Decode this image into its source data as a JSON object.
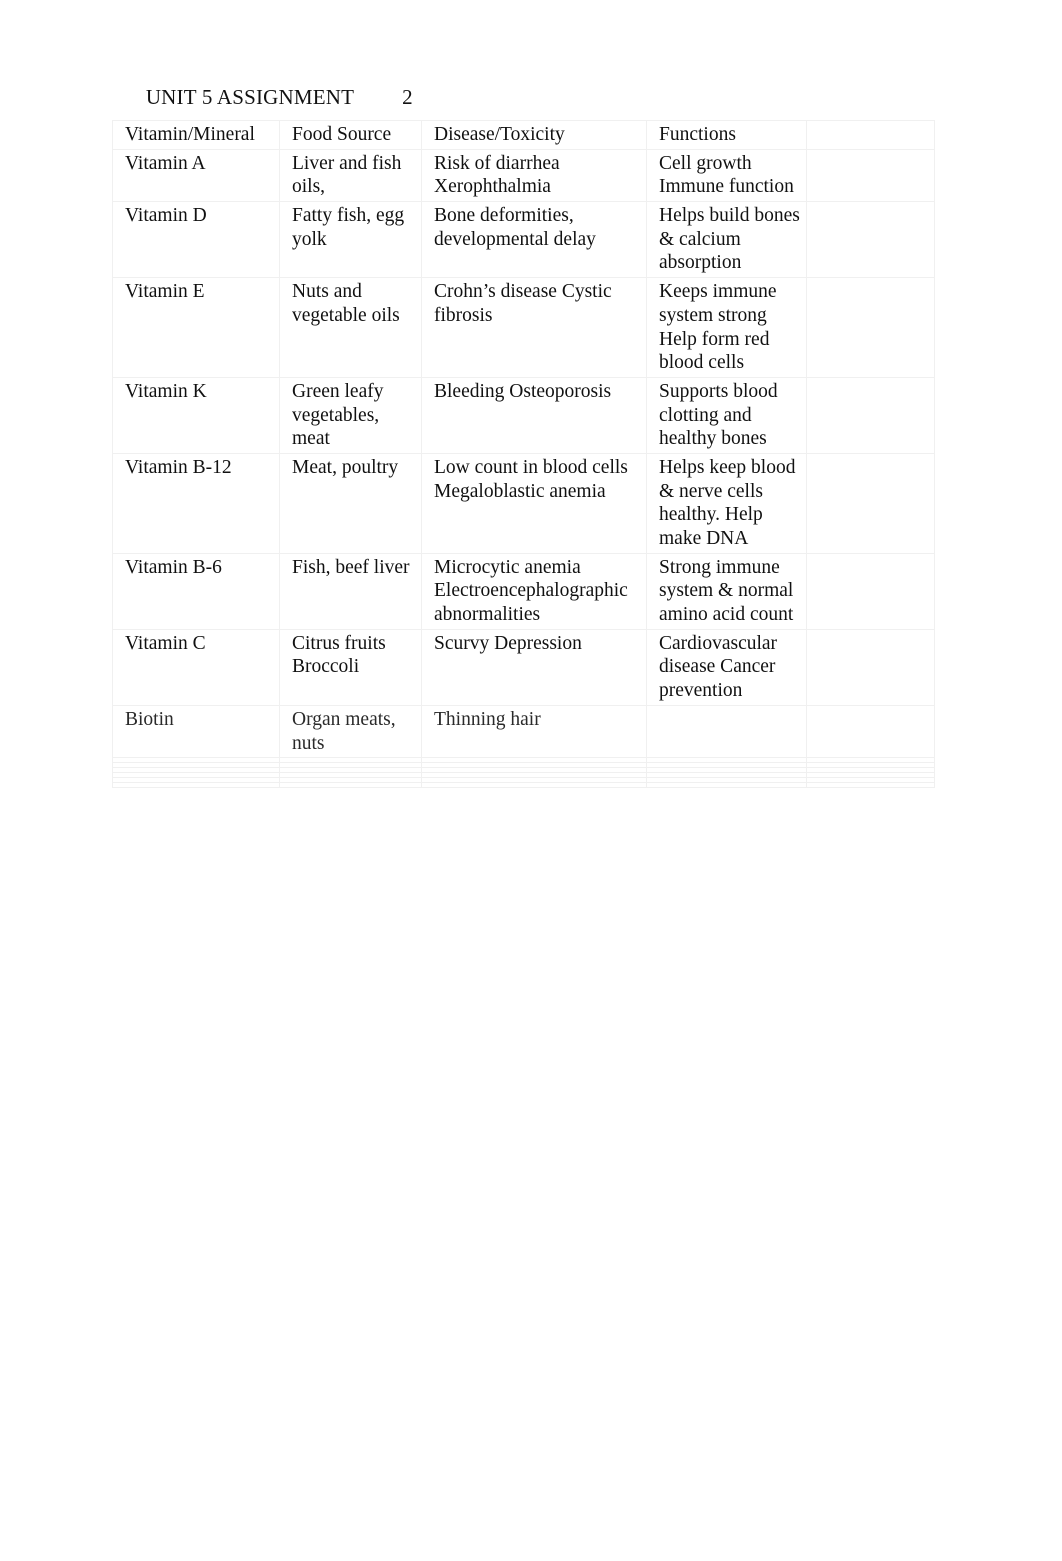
{
  "header": {
    "title": "UNIT 5 ASSIGNMENT",
    "page_number": "2"
  },
  "table": {
    "columns": [
      "Vitamin/Mineral",
      "Food Source",
      "Disease/Toxicity",
      "Functions",
      ""
    ],
    "rows": [
      {
        "legibility": "clear",
        "vitamin": "Vitamin A",
        "food_source": "Liver and fish oils,",
        "disease": "Risk of diarrhea\nXerophthalmia",
        "functions": "Cell growth\nImmune function",
        "extra": ""
      },
      {
        "legibility": "clear",
        "vitamin": "Vitamin D",
        "food_source": "Fatty fish, egg yolk",
        "disease": "Bone deformities, developmental delay",
        "functions": "Helps build bones & calcium absorption",
        "extra": ""
      },
      {
        "legibility": "clear",
        "vitamin": "Vitamin E",
        "food_source": "Nuts and vegetable oils",
        "disease": "Crohn’s disease\nCystic fibrosis",
        "functions": "Keeps immune system strong\nHelp form red blood cells",
        "extra": ""
      },
      {
        "legibility": "clear",
        "vitamin": "Vitamin K",
        "food_source": "Green leafy vegetables, meat",
        "disease": "Bleeding\nOsteoporosis",
        "functions": "Supports blood clotting and healthy bones",
        "extra": ""
      },
      {
        "legibility": "clear",
        "vitamin": "Vitamin B-12",
        "food_source": "Meat, poultry",
        "disease": "Low count in blood cells\nMegaloblastic anemia",
        "functions": "Helps keep blood & nerve cells healthy.\nHelp make DNA",
        "extra": ""
      },
      {
        "legibility": "clear",
        "vitamin": "Vitamin B-6",
        "food_source": "Fish, beef liver",
        "disease": "Microcytic anemia\nElectroencephalographic abnormalities",
        "functions": "Strong immune system & normal amino acid count",
        "extra": ""
      },
      {
        "legibility": "clear",
        "vitamin": "Vitamin C",
        "food_source": "Citrus fruits\nBroccoli",
        "disease": "Scurvy\nDepression",
        "functions": "Cardiovascular disease\nCancer prevention",
        "extra": ""
      },
      {
        "legibility": "partially-faded",
        "vitamin": "Biotin",
        "food_source": "Organ meats, nuts",
        "disease": "Thinning hair",
        "functions": "",
        "extra": ""
      },
      {
        "legibility": "illegible",
        "vitamin": "",
        "food_source": "",
        "disease": "",
        "functions": "",
        "extra": ""
      },
      {
        "legibility": "illegible",
        "vitamin": "",
        "food_source": "",
        "disease": "",
        "functions": "",
        "extra": ""
      },
      {
        "legibility": "illegible",
        "vitamin": "",
        "food_source": "",
        "disease": "",
        "functions": "",
        "extra": ""
      },
      {
        "legibility": "illegible",
        "vitamin": "",
        "food_source": "",
        "disease": "",
        "functions": "",
        "extra": ""
      },
      {
        "legibility": "illegible",
        "vitamin": "",
        "food_source": "",
        "disease": "",
        "functions": "",
        "extra": ""
      },
      {
        "legibility": "illegible",
        "vitamin": "",
        "food_source": "",
        "disease": "",
        "functions": "",
        "extra": ""
      }
    ]
  },
  "style": {
    "page_background": "#ffffff",
    "text_color": "#111111",
    "border_color": "#f0f0f0"
  }
}
